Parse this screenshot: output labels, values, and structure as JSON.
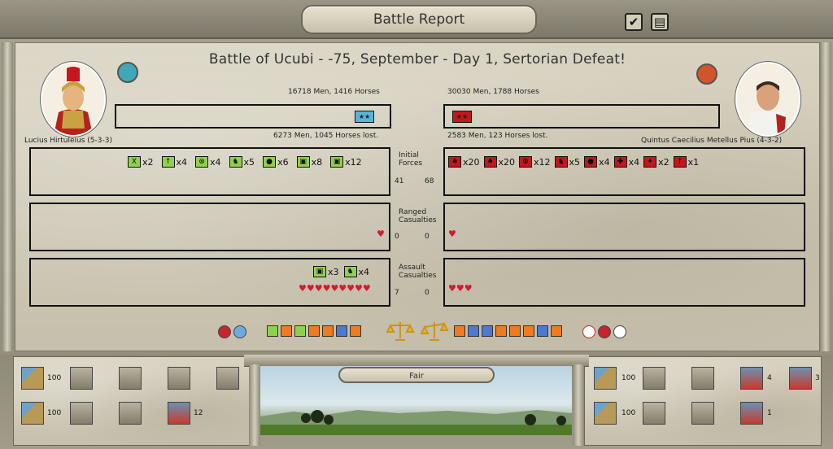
{
  "window": {
    "title": "Battle Report",
    "buttons": [
      {
        "name": "confirm",
        "glyph": "✔"
      },
      {
        "name": "menu",
        "glyph": "▤"
      }
    ]
  },
  "battle": {
    "title": "Battle of Ucubi - -75, September - Day 1, Sertorian Defeat!"
  },
  "left": {
    "commander": "Lucius Hirtuleius (5-3-3)",
    "men_horses": "16718 Men, 1416 Horses",
    "lost": "6273 Men, 1045 Horses lost.",
    "banner_glyph": "★★",
    "emblem_color": "#3fa7b5",
    "initial_units": [
      {
        "icon": "X",
        "count": "x2"
      },
      {
        "icon": "↑",
        "count": "x4"
      },
      {
        "icon": "⊗",
        "count": "x4"
      },
      {
        "icon": "♞",
        "count": "x5"
      },
      {
        "icon": "●",
        "count": "x6"
      },
      {
        "icon": "▣",
        "count": "x8"
      },
      {
        "icon": "▣",
        "count": "x12"
      }
    ],
    "initial_num": "41",
    "ranged_num": "0",
    "ranged_hearts": "♥",
    "assault_units": [
      {
        "icon": "▣",
        "count": "x3"
      },
      {
        "icon": "♞",
        "count": "x4"
      }
    ],
    "assault_num": "7",
    "assault_hearts": "♥♥♥♥♥♥♥♥♥"
  },
  "right": {
    "commander": "Quintus Caecilius Metellus Pius (4-3-2)",
    "men_horses": "30030 Men, 1788 Horses",
    "lost": "2583 Men, 123 Horses lost.",
    "banner_glyph": "★★",
    "emblem_color": "#d2552a",
    "initial_units": [
      {
        "icon": "♠",
        "count": "x20"
      },
      {
        "icon": "♠",
        "count": "x20"
      },
      {
        "icon": "⊗",
        "count": "x12"
      },
      {
        "icon": "♞",
        "count": "x5"
      },
      {
        "icon": "●",
        "count": "x4"
      },
      {
        "icon": "✚",
        "count": "x4"
      },
      {
        "icon": "✦",
        "count": "x2"
      },
      {
        "icon": "↑",
        "count": "x1"
      }
    ],
    "initial_num": "68",
    "ranged_num": "0",
    "ranged_hearts": "♥",
    "assault_num": "0",
    "assault_hearts": "♥♥♥"
  },
  "labels": {
    "initial": [
      "Initial",
      "Forces"
    ],
    "ranged": [
      "Ranged",
      "Casualties"
    ],
    "assault": [
      "Assault",
      "Casualties"
    ]
  },
  "weather": "Fair",
  "bottom_left": {
    "row1": [
      {
        "kind": "terrain",
        "value": "100"
      },
      {
        "kind": "unit",
        "value": ""
      },
      {
        "kind": "unit",
        "value": ""
      },
      {
        "kind": "unit",
        "value": ""
      },
      {
        "kind": "unit",
        "value": ""
      }
    ],
    "row2": [
      {
        "kind": "terrain",
        "value": "100"
      },
      {
        "kind": "unit",
        "value": ""
      },
      {
        "kind": "unit",
        "value": ""
      },
      {
        "kind": "red",
        "value": "12"
      }
    ]
  },
  "bottom_right": {
    "row1": [
      {
        "kind": "terrain",
        "value": "100"
      },
      {
        "kind": "unit",
        "value": ""
      },
      {
        "kind": "unit",
        "value": ""
      },
      {
        "kind": "red",
        "value": "4"
      },
      {
        "kind": "red",
        "value": "3"
      }
    ],
    "row2": [
      {
        "kind": "terrain",
        "value": "100"
      },
      {
        "kind": "unit",
        "value": ""
      },
      {
        "kind": "unit",
        "value": ""
      },
      {
        "kind": "red",
        "value": "1"
      }
    ]
  },
  "colors": {
    "roman_green": "#8fd24a",
    "enemy_red": "#c4161c",
    "heart": "#d21b2c"
  }
}
